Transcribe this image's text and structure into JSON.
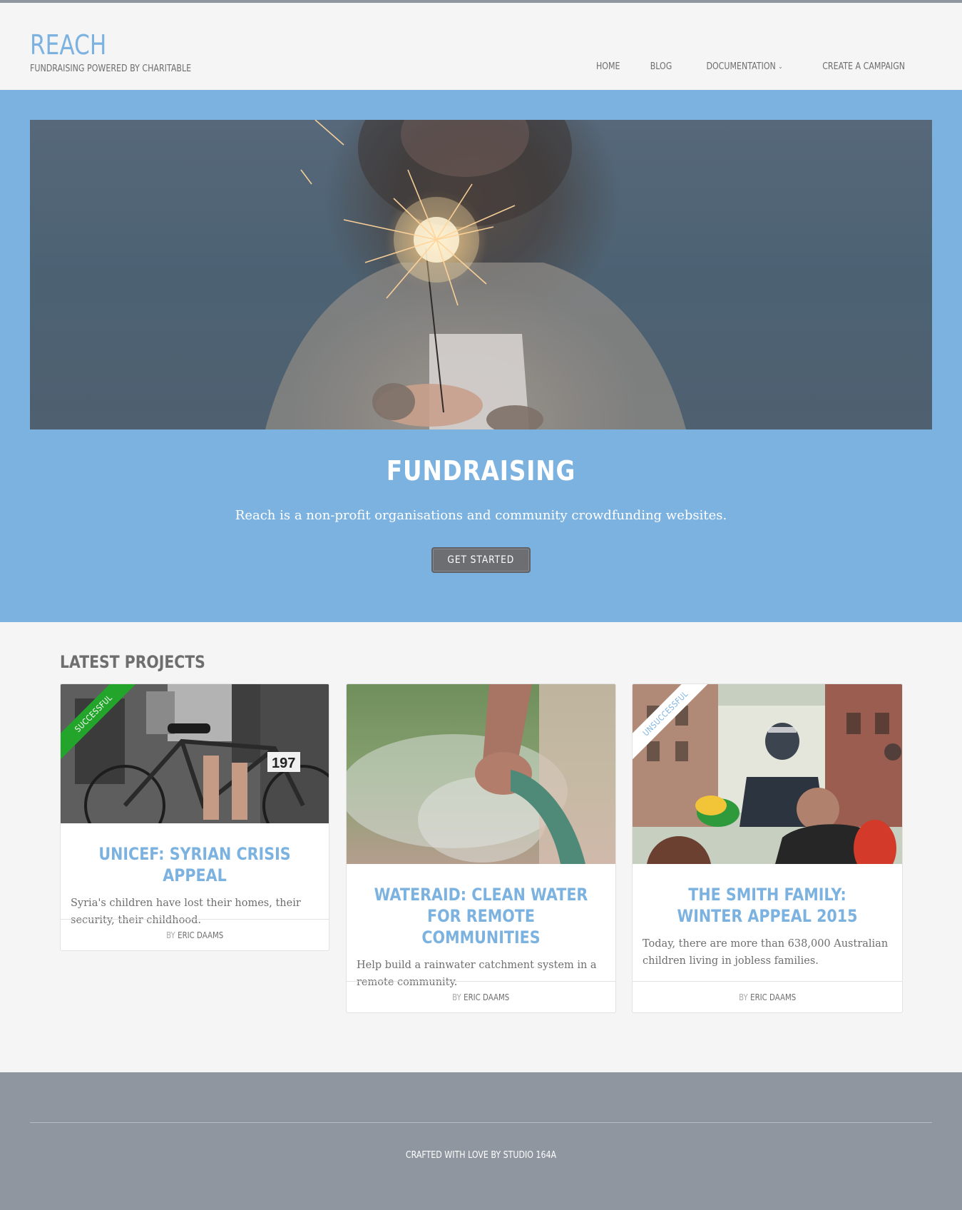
{
  "site": {
    "title": "REACH",
    "tagline": "FUNDRAISING POWERED BY CHARITABLE"
  },
  "nav": {
    "items": [
      {
        "label": "HOME"
      },
      {
        "label": "BLOG"
      },
      {
        "label": "DOCUMENTATION"
      },
      {
        "label": "CREATE A CAMPAIGN"
      }
    ]
  },
  "hero": {
    "title": "FUNDRAISING",
    "text": "Reach is a non-profit organisations and community crowdfunding websites.",
    "button_label": "GET STARTED"
  },
  "projects": {
    "heading": "LATEST PROJECTS",
    "items": [
      {
        "title": "UNICEF: SYRIAN CRISIS APPEAL",
        "excerpt": "Syria's children have lost their homes, their security, their childhood.",
        "by": "BY",
        "author": "ERIC DAAMS",
        "status": "SUCCESSFUL"
      },
      {
        "title": "WATERAID: CLEAN WATER FOR REMOTE COMMUNITIES",
        "excerpt": "Help build a rainwater catchment system in a remote community.",
        "by": "BY",
        "author": "ERIC DAAMS"
      },
      {
        "title": "THE SMITH FAMILY: WINTER APPEAL 2015",
        "excerpt": "Today, there are more than 638,000 Australian children living in jobless families.",
        "by": "BY",
        "author": "ERIC DAAMS",
        "status": "UNSUCCESSFUL"
      }
    ]
  },
  "footer": {
    "credit": "CRAFTED WITH LOVE BY STUDIO 164A"
  },
  "colors": {
    "accent": "#7cb2e0",
    "success": "#22a52a",
    "footer_bg": "#8f969f",
    "button_bg": "#6d6e72"
  }
}
